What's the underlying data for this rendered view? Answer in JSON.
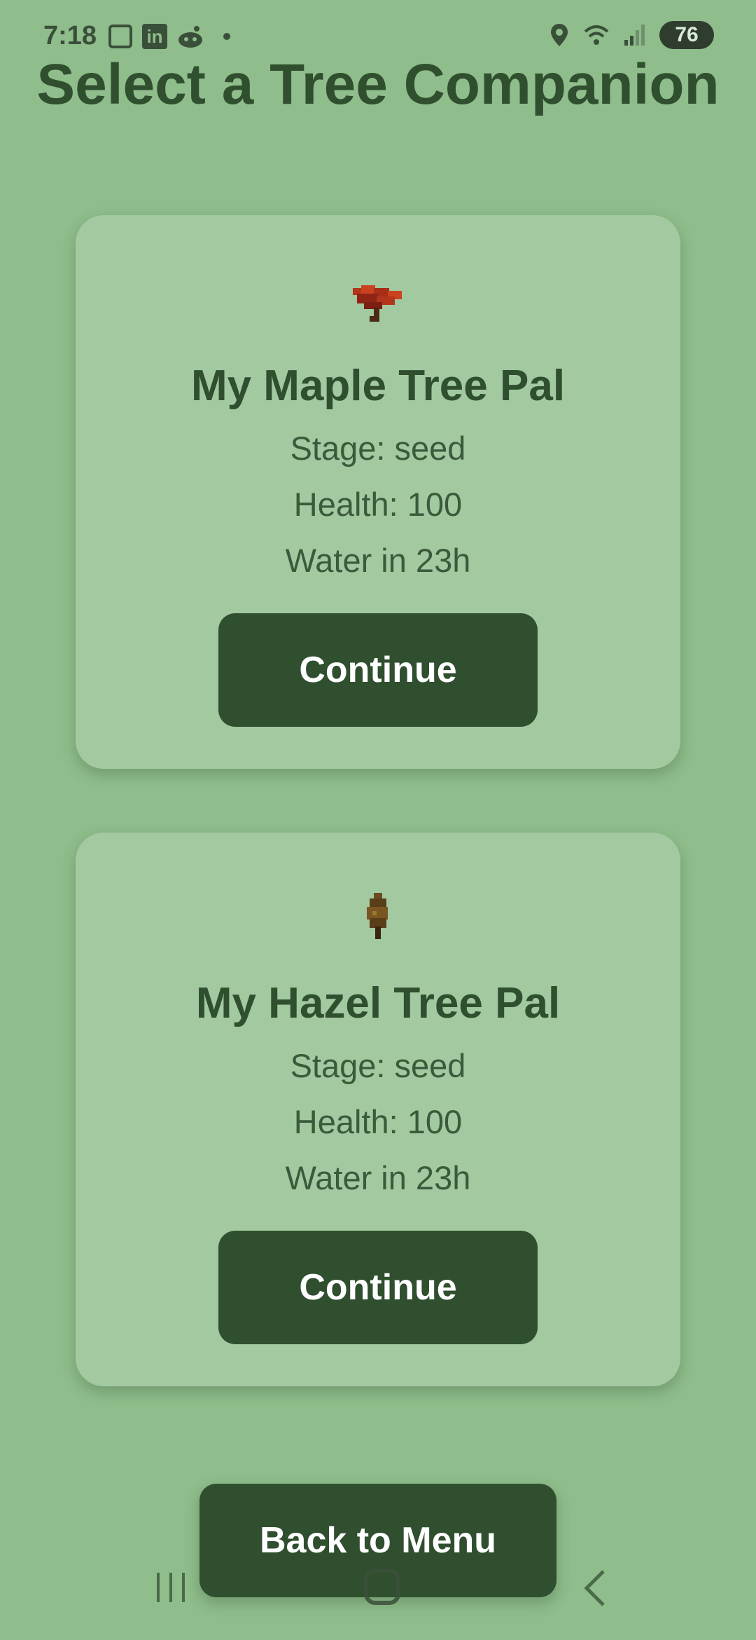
{
  "status_bar": {
    "time": "7:18",
    "battery": "76",
    "icons": [
      "screenshot-icon",
      "linkedin-icon",
      "reddit-icon",
      "dot-icon",
      "location-icon",
      "wifi-icon",
      "signal-icon",
      "battery-icon"
    ]
  },
  "page": {
    "title": "Select a Tree Companion"
  },
  "cards": [
    {
      "name": "My Maple Tree Pal",
      "stage": "Stage: seed",
      "health": "Health: 100",
      "water": "Water in 23h",
      "button": "Continue",
      "icon": "maple-tree-icon"
    },
    {
      "name": "My Hazel Tree Pal",
      "stage": "Stage: seed",
      "health": "Health: 100",
      "water": "Water in 23h",
      "button": "Continue",
      "icon": "hazel-tree-icon"
    }
  ],
  "footer": {
    "back_label": "Back to Menu"
  },
  "colors": {
    "background": "#8fbd8b",
    "card": "#a2c9a0",
    "primary": "#2f4f2f",
    "button_text": "#ffffff"
  }
}
